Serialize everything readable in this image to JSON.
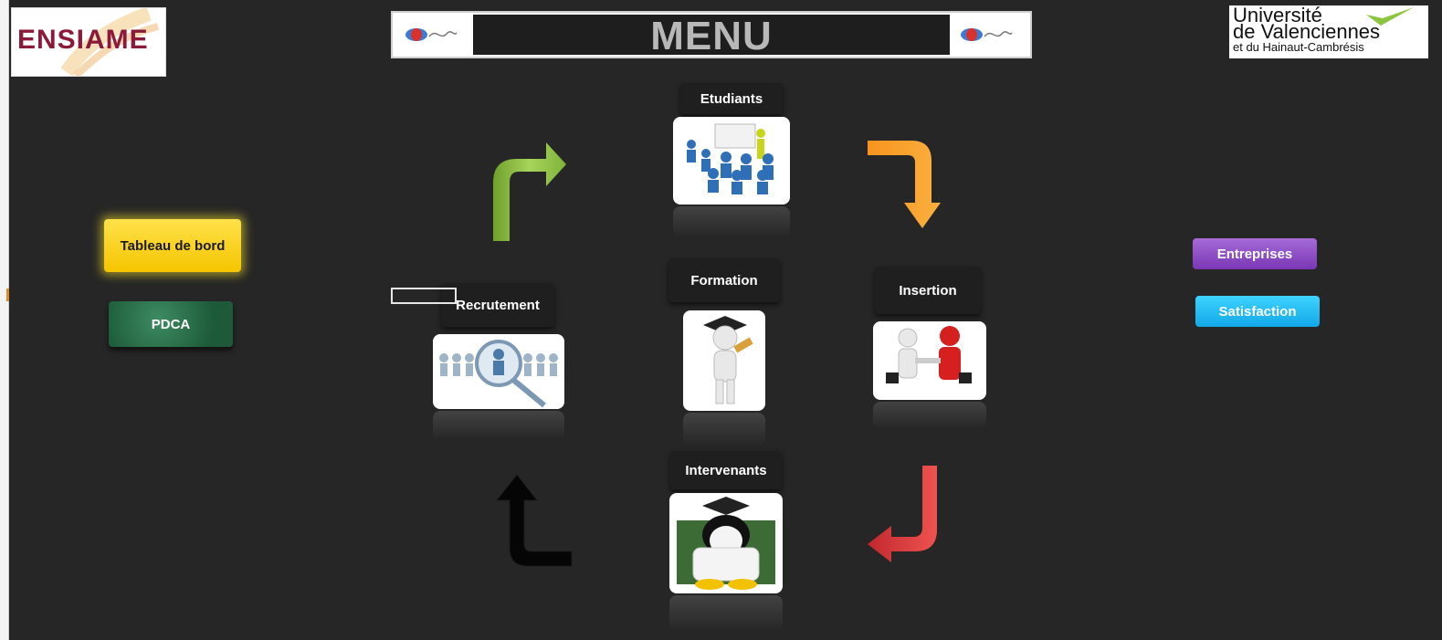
{
  "logos": {
    "ensiame": "ENSIAME",
    "university": {
      "line1": "Université",
      "line2": "de Valenciennes",
      "line3": "et du Hainaut-Cambrésis"
    }
  },
  "banner": {
    "title": "MENU"
  },
  "nodes": {
    "etudiants": "Etudiants",
    "formation": "Formation",
    "recrutement": "Recrutement",
    "insertion": "Insertion",
    "intervenants": "Intervenants"
  },
  "buttons": {
    "tableau_de_bord": "Tableau de bord",
    "pdca": "PDCA",
    "entreprises": "Entreprises",
    "satisfaction": "Satisfaction"
  },
  "colors": {
    "background": "#262626",
    "tableau": "#f5c500",
    "pdca": "#2a6e49",
    "entreprises": "#8a45c2",
    "satisfaction": "#1bb6f0",
    "arrow_green": "#8cc63f",
    "arrow_orange": "#f7941d",
    "arrow_red": "#d9312b",
    "arrow_black": "#050505"
  }
}
